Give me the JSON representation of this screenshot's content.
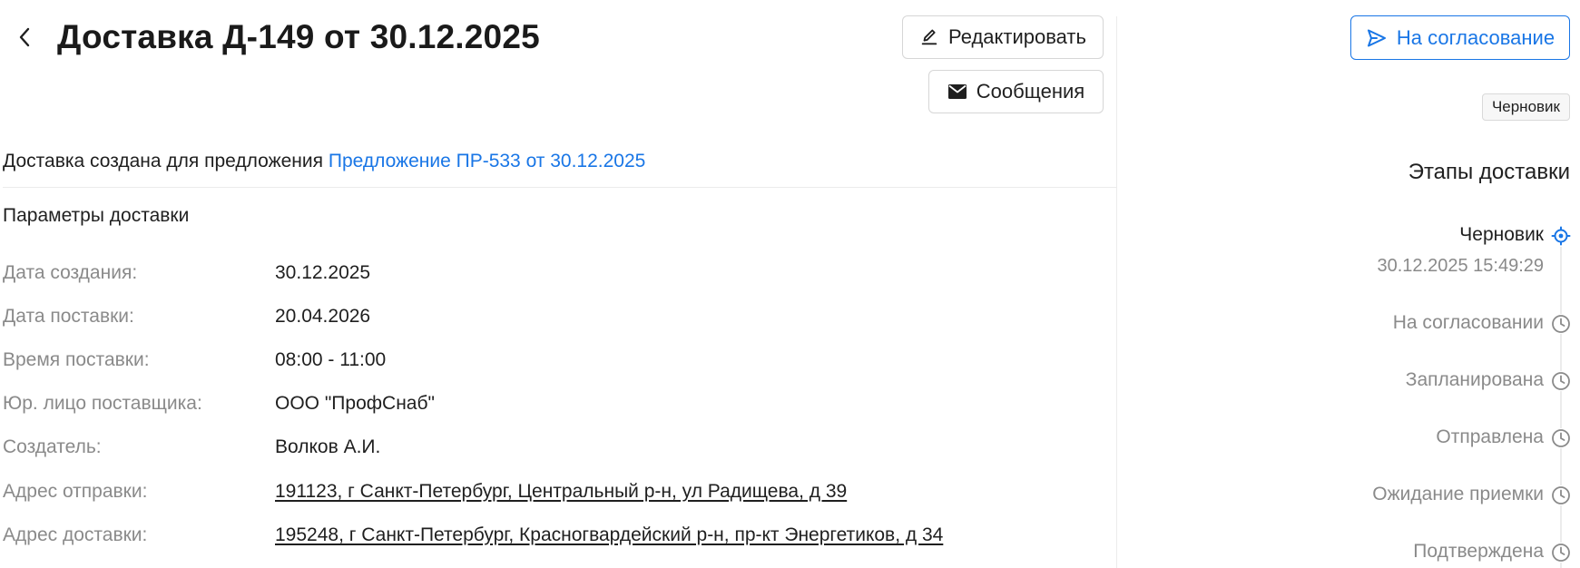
{
  "header": {
    "title": "Доставка Д-149 от 30.12.2025",
    "edit_label": "Редактировать",
    "messages_label": "Сообщения"
  },
  "origin": {
    "prefix": "Доставка создана для предложения",
    "link": "Предложение ПР-533 от 30.12.2025"
  },
  "params": {
    "title": "Параметры доставки",
    "rows": [
      {
        "label": "Дата создания:",
        "value": "30.12.2025"
      },
      {
        "label": "Дата поставки:",
        "value": "20.04.2026"
      },
      {
        "label": "Время поставки:",
        "value": "08:00 - 11:00"
      },
      {
        "label": "Юр. лицо поставщика:",
        "value": "ООО \"ПрофСнаб\""
      },
      {
        "label": "Создатель:",
        "value": "Волков А.И."
      },
      {
        "label": "Адрес отправки:",
        "value": "191123, г Санкт-Петербург, Центральный р-н, ул Радищева, д 39"
      },
      {
        "label": "Адрес доставки:",
        "value": "195248, г Санкт-Петербург, Красногвардейский р-н, пр-кт Энергетиков, д 34"
      }
    ]
  },
  "sidebar": {
    "approve_label": "На согласование",
    "status_badge": "Черновик",
    "stages_title": "Этапы доставки",
    "stages": [
      {
        "label": "Черновик",
        "time": "30.12.2025 15:49:29",
        "state": "active",
        "icon": "target-icon"
      },
      {
        "label": "На согласовании",
        "state": "pending",
        "icon": "clock-icon"
      },
      {
        "label": "Запланирована",
        "state": "pending",
        "icon": "clock-icon"
      },
      {
        "label": "Отправлена",
        "state": "pending",
        "icon": "clock-icon"
      },
      {
        "label": "Ожидание приемки",
        "state": "pending",
        "icon": "clock-icon"
      },
      {
        "label": "Подтверждена",
        "state": "pending",
        "icon": "clock-icon"
      }
    ]
  },
  "colors": {
    "accent": "#1976e6",
    "muted_text": "#8a8a8a",
    "text": "#1f1f1f"
  }
}
